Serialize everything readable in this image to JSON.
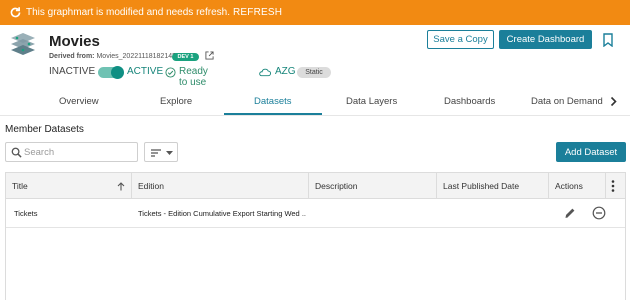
{
  "banner": {
    "message": "This graphmart is modified and needs refresh.",
    "refresh_label": "REFRESH"
  },
  "header": {
    "title": "Movies",
    "derived_label": "Derived from:",
    "derived_value": "Movies_20221118182145",
    "dev_badge": "DEV 1",
    "inactive_label": "INACTIVE",
    "active_label": "ACTIVE",
    "ready_label": "Ready to use",
    "azg_label": "AZG",
    "static_badge": "Static",
    "save_copy_label": "Save a Copy",
    "create_dashboard_label": "Create Dashboard"
  },
  "tabs": [
    {
      "label": "Overview"
    },
    {
      "label": "Explore"
    },
    {
      "label": "Datasets"
    },
    {
      "label": "Data Layers"
    },
    {
      "label": "Dashboards"
    },
    {
      "label": "Data on Demand"
    }
  ],
  "active_tab": "Datasets",
  "member_datasets": {
    "title": "Member Datasets",
    "search_placeholder": "Search",
    "add_dataset_label": "Add Dataset",
    "columns": [
      "Title",
      "Edition",
      "Description",
      "Last Published Date",
      "Actions"
    ],
    "rows": [
      {
        "title": "Tickets",
        "edition": "Tickets - Edition Cumulative Export Starting Wed ...",
        "description": "",
        "last_published_date": ""
      }
    ]
  },
  "colors": {
    "banner": "#f28a12",
    "primary": "#1b7f9a",
    "active_green": "#16857a",
    "dev_badge": "#1aa27f"
  },
  "icons": [
    "refresh-icon",
    "graphmart-logo-icon",
    "external-link-icon",
    "check-circle-icon",
    "cloud-icon",
    "bookmark-icon",
    "chevron-right-icon",
    "search-icon",
    "sort-lines-icon",
    "caret-down-icon",
    "arrow-up-icon",
    "kebab-menu-icon",
    "pencil-icon",
    "minus-circle-icon"
  ]
}
